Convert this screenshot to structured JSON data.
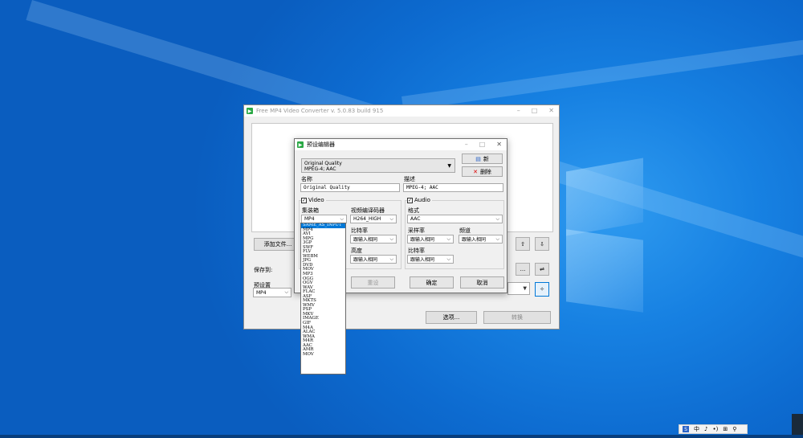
{
  "main_window": {
    "title": "Free MP4 Video Converter  v. 5.0.83 build 915",
    "buttons": {
      "minimize": "–",
      "maximize": "□",
      "close": "✕"
    },
    "add_files_label": "添加文件...",
    "save_to_label": "保存到:",
    "preset_label": "预设置",
    "preset_value": "MP4",
    "browse_label": "...",
    "options_label": "选项...",
    "convert_label": "转换",
    "up_label": "⇧",
    "down_label": "⇩"
  },
  "dialog": {
    "title": "预设编辑器",
    "preset": {
      "line1": "Original Quality",
      "line2": "MPEG-4; AAC"
    },
    "new_label": "新",
    "delete_label": "删除",
    "name_label": "名称",
    "name_value": "Original Quality",
    "description_label": "描述",
    "description_value": "MPEG-4; AAC",
    "video_group_label": "Video",
    "audio_group_label": "Audio",
    "container_label": "集装箱",
    "container_value": "MP4",
    "video_codec_label": "视频编译码器",
    "video_codec_value": "H264_HIGH",
    "video_bitrate_label": "比特率",
    "video_bitrate_value": "跟输入相同",
    "height_label": "高度",
    "height_value": "跟输入相同",
    "audio_format_label": "格式",
    "audio_format_value": "AAC",
    "sample_rate_label": "采样率",
    "sample_rate_value": "跟输入相同",
    "channels_label": "频道",
    "channels_value": "跟输入相同",
    "audio_bitrate_label": "比特率",
    "audio_bitrate_value": "跟输入相同",
    "reset_label": "重设",
    "ok_label": "确定",
    "cancel_label": "取消"
  },
  "container_options": [
    "SAME_AS_INPUT",
    "MP4",
    "AVI",
    "MPG",
    "3GP",
    "SWF",
    "FLV",
    "WEBM",
    "JPG",
    "DVD",
    "MOV",
    "MP3",
    "OGG",
    "OGV",
    "WAV",
    "FLAC",
    "ASF",
    "MKTS",
    "WMV",
    "PSP",
    "MKV",
    "IMAGE",
    "GIF",
    "M4A",
    "ALAC",
    "WMA",
    "M4R",
    "AAC",
    "AMR",
    "MOV"
  ],
  "selected_container_index": 0,
  "tray": {
    "ime": "中",
    "items": [
      "♪",
      "•)",
      "⊞",
      "中",
      "⚲"
    ]
  },
  "colors": {
    "selection": "#0078d7",
    "desktop": "#0d6bd0"
  }
}
